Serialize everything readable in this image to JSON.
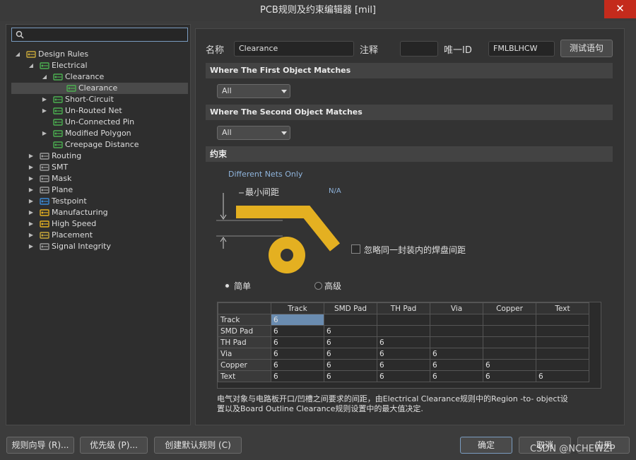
{
  "window": {
    "title": "PCB规则及约束编辑器 [mil]",
    "close_glyph": "✕"
  },
  "search": {
    "placeholder": ""
  },
  "tree": [
    {
      "label": "Design Rules",
      "level": 0,
      "arrow": "◢",
      "icon": "rules-folder-icon"
    },
    {
      "label": "Electrical",
      "level": 1,
      "arrow": "◢",
      "icon": "electrical-rule-icon"
    },
    {
      "label": "Clearance",
      "level": 2,
      "arrow": "◢",
      "icon": "clearance-rule-icon"
    },
    {
      "label": "Clearance",
      "level": 3,
      "arrow": "",
      "icon": "clearance-rule-icon",
      "selected": true
    },
    {
      "label": "Short-Circuit",
      "level": 2,
      "arrow": "▶",
      "icon": "short-circuit-rule-icon"
    },
    {
      "label": "Un-Routed Net",
      "level": 2,
      "arrow": "▶",
      "icon": "unrouted-net-rule-icon"
    },
    {
      "label": "Un-Connected Pin",
      "level": 2,
      "arrow": "",
      "icon": "unconnected-pin-rule-icon"
    },
    {
      "label": "Modified Polygon",
      "level": 2,
      "arrow": "▶",
      "icon": "polygon-rule-icon"
    },
    {
      "label": "Creepage Distance",
      "level": 2,
      "arrow": "",
      "icon": "creepage-rule-icon"
    },
    {
      "label": "Routing",
      "level": 1,
      "arrow": "▶",
      "icon": "routing-icon"
    },
    {
      "label": "SMT",
      "level": 1,
      "arrow": "▶",
      "icon": "smt-icon"
    },
    {
      "label": "Mask",
      "level": 1,
      "arrow": "▶",
      "icon": "mask-icon"
    },
    {
      "label": "Plane",
      "level": 1,
      "arrow": "▶",
      "icon": "plane-icon"
    },
    {
      "label": "Testpoint",
      "level": 1,
      "arrow": "▶",
      "icon": "testpoint-icon"
    },
    {
      "label": "Manufacturing",
      "level": 1,
      "arrow": "▶",
      "icon": "manufacturing-icon"
    },
    {
      "label": "High Speed",
      "level": 1,
      "arrow": "▶",
      "icon": "high-speed-icon"
    },
    {
      "label": "Placement",
      "level": 1,
      "arrow": "▶",
      "icon": "placement-icon"
    },
    {
      "label": "Signal Integrity",
      "level": 1,
      "arrow": "▶",
      "icon": "signal-integrity-icon"
    }
  ],
  "rule": {
    "name_label": "名称",
    "name_value": "Clearance",
    "comment_label": "注释",
    "comment_value": "",
    "uid_label": "唯一ID",
    "uid_value": "FMLBLHCW",
    "test_button": "测试语句"
  },
  "first_match": {
    "heading": "Where The First Object Matches",
    "value": "All"
  },
  "second_match": {
    "heading": "Where The Second Object Matches",
    "value": "All"
  },
  "constraints": {
    "heading": "约束",
    "net_scope": "Different Nets Only",
    "min_clearance_label": "最小间距",
    "min_clearance_value": "N/A",
    "ignore_pad_label": "忽略同一封装内的焊盘间距",
    "ignore_pad_checked": false,
    "mode_simple": "简单",
    "mode_advanced": "高级",
    "mode_selected": "simple",
    "graphic_color": "#e4b021"
  },
  "matrix": {
    "columns": [
      "Track",
      "SMD Pad",
      "TH Pad",
      "Via",
      "Copper",
      "Text"
    ],
    "rows": [
      {
        "label": "Track",
        "values": [
          "6",
          "",
          "",
          "",
          "",
          ""
        ]
      },
      {
        "label": "SMD Pad",
        "values": [
          "6",
          "6",
          "",
          "",
          "",
          ""
        ]
      },
      {
        "label": "TH Pad",
        "values": [
          "6",
          "6",
          "6",
          "",
          "",
          ""
        ]
      },
      {
        "label": "Via",
        "values": [
          "6",
          "6",
          "6",
          "6",
          "",
          ""
        ]
      },
      {
        "label": "Copper",
        "values": [
          "6",
          "6",
          "6",
          "6",
          "6",
          ""
        ]
      },
      {
        "label": "Text",
        "values": [
          "6",
          "6",
          "6",
          "6",
          "6",
          "6"
        ]
      }
    ]
  },
  "description": {
    "line1": "电气对象与电路板开口/凹槽之间要求的间距，由Electrical Clearance规则中的Region -to- object设",
    "line2": "置以及Board Outline Clearance规则设置中的最大值决定."
  },
  "footer": {
    "wizard": "规则向导 (R)...",
    "priority": "优先级 (P)...",
    "create_default": "创建默认规则 (C)",
    "ok": "确定",
    "cancel": "取消",
    "apply": "应用",
    "watermark": "CSDN @NCHEWZP"
  }
}
